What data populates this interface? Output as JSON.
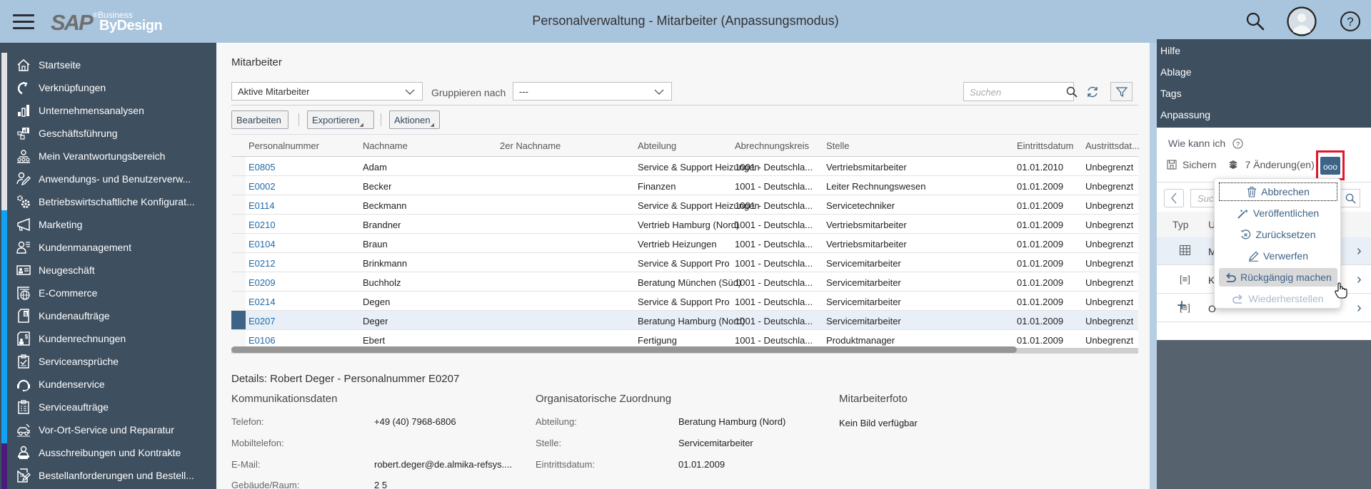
{
  "header": {
    "logo_brand": "SAP",
    "logo_business": "Business",
    "logo_product": "ByDesign",
    "title": "Personalverwaltung - Mitarbeiter (Anpassungsmodus)",
    "icons": [
      "menu-icon",
      "search-icon",
      "avatar-icon",
      "help-icon"
    ]
  },
  "nav": {
    "items": [
      {
        "label": "Startseite",
        "icon": "home-icon"
      },
      {
        "label": "Verknüpfungen",
        "icon": "redo-arrow-icon"
      },
      {
        "label": "Unternehmensanalysen",
        "icon": "bar-chart-icon"
      },
      {
        "label": "Geschäftsführung",
        "icon": "dashboard-icon"
      },
      {
        "label": "Mein Verantwortungsbereich",
        "icon": "team-icon"
      },
      {
        "label": "Anwendungs- und Benutzerverw...",
        "icon": "user-edit-icon"
      },
      {
        "label": "Betriebswirtschaftliche Konfigurat...",
        "icon": "gears-icon"
      },
      {
        "label": "Marketing",
        "icon": "megaphone-icon"
      },
      {
        "label": "Kundenmanagement",
        "icon": "customer-list-icon"
      },
      {
        "label": "Neugeschäft",
        "icon": "business-card-icon"
      },
      {
        "label": "E-Commerce",
        "icon": "globe-window-icon"
      },
      {
        "label": "Kundenaufträge",
        "icon": "sales-document-icon"
      },
      {
        "label": "Kundenrechnungen",
        "icon": "invoice-icon"
      },
      {
        "label": "Serviceansprüche",
        "icon": "clipboard-check-icon"
      },
      {
        "label": "Kundenservice",
        "icon": "headset-icon"
      },
      {
        "label": "Serviceaufträge",
        "icon": "clipboard-list-icon"
      },
      {
        "label": "Vor-Ort-Service und Reparatur",
        "icon": "car-repair-icon"
      },
      {
        "label": "Ausschreibungen und Kontrakte",
        "icon": "person-desk-icon"
      },
      {
        "label": "Bestellanforderungen und Bestell...",
        "icon": "document-edit-icon"
      }
    ]
  },
  "main": {
    "section_title": "Mitarbeiter",
    "view_select": "Aktive Mitarbeiter",
    "group_by_label": "Gruppieren nach",
    "group_by_value": "---",
    "search_placeholder": "Suchen",
    "toolbar": {
      "edit": "Bearbeiten",
      "export": "Exportieren",
      "actions": "Aktionen"
    },
    "table": {
      "columns": [
        "Personalnummer",
        "Nachname",
        "2er Nachname",
        "Abteilung",
        "Abrechnungskreis",
        "Stelle",
        "Eintrittsdatum",
        "Austrittsdat..."
      ],
      "rows": [
        {
          "id": "E0805",
          "name": "Adam",
          "name2": "",
          "dept": "Service & Support Heizungen",
          "payroll": "1001 - Deutschla...",
          "job": "Vertriebsmitarbeiter",
          "start": "01.01.2010",
          "end": "Unbegrenzt"
        },
        {
          "id": "E0002",
          "name": "Becker",
          "name2": "",
          "dept": "Finanzen",
          "payroll": "1001 - Deutschla...",
          "job": "Leiter Rechnungswesen",
          "start": "01.01.2009",
          "end": "Unbegrenzt"
        },
        {
          "id": "E0114",
          "name": "Beckmann",
          "name2": "",
          "dept": "Service & Support Heizungen",
          "payroll": "1001 - Deutschla...",
          "job": "Servicetechniker",
          "start": "01.01.2009",
          "end": "Unbegrenzt"
        },
        {
          "id": "E0210",
          "name": "Brandner",
          "name2": "",
          "dept": "Vertrieb Hamburg (Nord)",
          "payroll": "1001 - Deutschla...",
          "job": "Vertriebsmitarbeiter",
          "start": "01.01.2009",
          "end": "Unbegrenzt"
        },
        {
          "id": "E0104",
          "name": "Braun",
          "name2": "",
          "dept": "Vertrieb Heizungen",
          "payroll": "1001 - Deutschla...",
          "job": "Vertriebsmitarbeiter",
          "start": "01.01.2009",
          "end": "Unbegrenzt"
        },
        {
          "id": "E0212",
          "name": "Brinkmann",
          "name2": "",
          "dept": "Service & Support Pro",
          "payroll": "1001 - Deutschla...",
          "job": "Servicemitarbeiter",
          "start": "01.01.2009",
          "end": "Unbegrenzt"
        },
        {
          "id": "E0209",
          "name": "Buchholz",
          "name2": "",
          "dept": "Beratung München (Süd)",
          "payroll": "1001 - Deutschla...",
          "job": "Servicemitarbeiter",
          "start": "01.01.2009",
          "end": "Unbegrenzt"
        },
        {
          "id": "E0214",
          "name": "Degen",
          "name2": "",
          "dept": "Service & Support Pro",
          "payroll": "1001 - Deutschla...",
          "job": "Servicemitarbeiter",
          "start": "01.01.2009",
          "end": "Unbegrenzt"
        },
        {
          "id": "E0207",
          "name": "Deger",
          "name2": "",
          "dept": "Beratung Hamburg (Nord)",
          "payroll": "1001 - Deutschla...",
          "job": "Servicemitarbeiter",
          "start": "01.01.2009",
          "end": "Unbegrenzt",
          "selected": true
        },
        {
          "id": "E0106",
          "name": "Ebert",
          "name2": "",
          "dept": "Fertigung",
          "payroll": "1001 - Deutschla...",
          "job": "Produktmanager",
          "start": "01.01.2009",
          "end": "Unbegrenzt"
        }
      ]
    },
    "details": {
      "title": "Details: Robert Deger - Personalnummer E0207",
      "communication": {
        "heading": "Kommunikationsdaten",
        "phone_label": "Telefon:",
        "phone": "+49 (40) 7968-6806",
        "mobile_label": "Mobiltelefon:",
        "mobile": "",
        "email_label": "E-Mail:",
        "email": "robert.deger@de.almika-refsys....",
        "room_label": "Gebäude/Raum:",
        "room": "2 5"
      },
      "org": {
        "heading": "Organisatorische Zuordnung",
        "dept_label": "Abteilung:",
        "dept": "Beratung Hamburg (Nord)",
        "job_label": "Stelle:",
        "job": "Servicemitarbeiter",
        "start_label": "Eintrittsdatum:",
        "start": "01.01.2009"
      },
      "photo": {
        "heading": "Mitarbeiterfoto",
        "text": "Kein Bild verfügbar"
      }
    }
  },
  "right_panel": {
    "menu": [
      "Hilfe",
      "Ablage",
      "Tags",
      "Anpassung"
    ],
    "howto": "Wie kann ich",
    "save": "Sichern",
    "changes": "7 Änderung(en)",
    "more": "ooo",
    "search_placeholder": "Suchen",
    "col_type": "Typ",
    "col_label": "U",
    "rows": [
      {
        "type_icon": "table-icon",
        "label": "M"
      },
      {
        "type_icon": "form-icon",
        "label": "K"
      },
      {
        "type_icon": "form-icon",
        "label": "O"
      }
    ]
  },
  "popover": {
    "items": [
      {
        "label": "Abbrechen",
        "icon": "trash-icon",
        "state": "focused"
      },
      {
        "label": "Veröffentlichen",
        "icon": "magic-wand-icon",
        "state": "normal"
      },
      {
        "label": "Zurücksetzen",
        "icon": "reset-icon",
        "state": "normal"
      },
      {
        "label": "Verwerfen",
        "icon": "pencil-icon",
        "state": "normal"
      },
      {
        "label": "Rückgängig machen",
        "icon": "undo-icon",
        "state": "hover"
      },
      {
        "label": "Wiederherstellen",
        "icon": "redo-icon",
        "state": "disabled"
      }
    ]
  },
  "colors": {
    "shell": "#a9c4dd",
    "nav_bg": "#3e4f60",
    "accent": "#3d6387",
    "link": "#1f6aa8",
    "highlight_border": "#e0162b"
  }
}
